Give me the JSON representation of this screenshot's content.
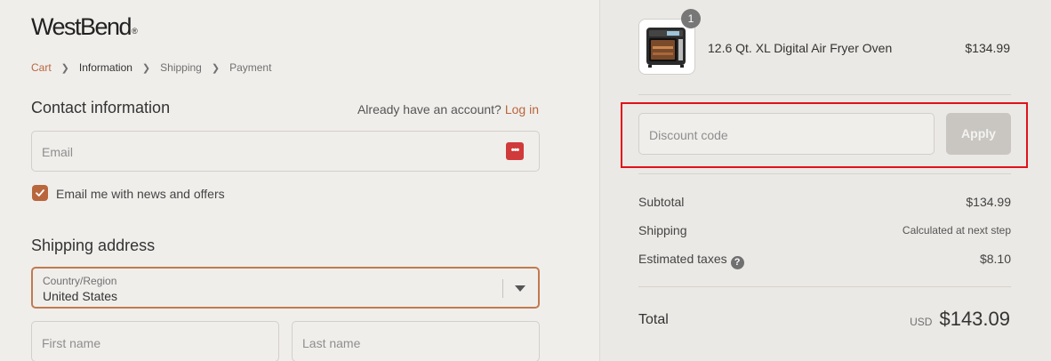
{
  "brand": {
    "name": "WestBend",
    "reg_mark": "®"
  },
  "breadcrumb": [
    {
      "label": "Cart"
    },
    {
      "label": "Information"
    },
    {
      "label": "Shipping"
    },
    {
      "label": "Payment"
    }
  ],
  "contact": {
    "title": "Contact information",
    "account_prompt": "Already have an account?",
    "login_label": "Log in",
    "email_placeholder": "Email",
    "newsletter_label": "Email me with news and offers",
    "newsletter_checked": true
  },
  "shipping": {
    "title": "Shipping address",
    "country_label": "Country/Region",
    "country_value": "United States",
    "first_name_placeholder": "First name",
    "last_name_placeholder": "Last name"
  },
  "order": {
    "item": {
      "name": "12.6 Qt. XL Digital Air Fryer Oven",
      "price": "$134.99",
      "quantity": "1"
    },
    "discount_placeholder": "Discount code",
    "apply_label": "Apply",
    "subtotal_label": "Subtotal",
    "subtotal_value": "$134.99",
    "shipping_label": "Shipping",
    "shipping_value": "Calculated at next step",
    "taxes_label": "Estimated taxes",
    "taxes_value": "$8.10",
    "total_label": "Total",
    "currency": "USD",
    "total_value": "$143.09"
  },
  "colors": {
    "accent": "#b9663d",
    "highlight": "#e0111b",
    "apply_disabled": "#c9c6c1"
  }
}
